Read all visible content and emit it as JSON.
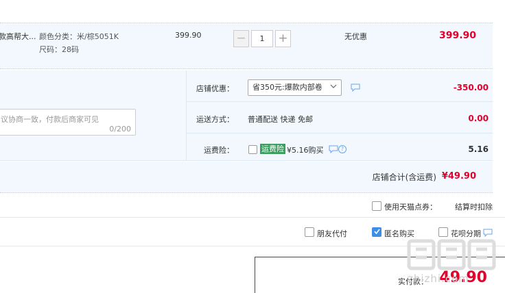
{
  "item": {
    "title": "款高帮大...",
    "sku_color": "颜色分类：米/棕5051K",
    "sku_size": "尺码：28码",
    "unit_price": "399.90",
    "quantity": "1",
    "qty_minus": "−",
    "qty_plus": "+",
    "promo": "无优惠",
    "line_total": "399.90"
  },
  "options": {
    "shop_discount_label": "店铺优惠：",
    "coupon_selected": "省350元:爆款内部卷",
    "discount_amount": "-350.00",
    "shipping_label": "运送方式：",
    "shipping_value": "普通配送 快递 免邮",
    "shipping_amount": "0.00",
    "insurance_label": "运费险：",
    "insurance_tag": "运费险",
    "insurance_price": "¥5.16购买",
    "insurance_amount": "5.16",
    "help_glyph": "?"
  },
  "memo": {
    "placeholder": "议协商一致，付款后商家可见",
    "counter": "0/200"
  },
  "shop_total": {
    "label": "店铺合计(含运费)",
    "value": "¥49.90"
  },
  "points": {
    "label": "使用天猫点券：",
    "deduct": "结算时扣除"
  },
  "bottom_options": {
    "friend_pay": "朋友代付",
    "anonymous": "匿名购买",
    "anonymous_checked": true,
    "huabei": "花呗分期"
  },
  "pay": {
    "label": "实付款：",
    "value": "49.90"
  },
  "watermark": {
    "logo_text": "值值值",
    "site": "zhizhi.com"
  },
  "colors": {
    "price_red": "#e4002b",
    "panel_bg": "#f3f8fe",
    "accent_blue": "#3d8ee8",
    "insurance_green": "#3e9e61"
  },
  "icons": [
    "chevron-down-icon",
    "chat-icon",
    "help-icon",
    "check-icon"
  ]
}
